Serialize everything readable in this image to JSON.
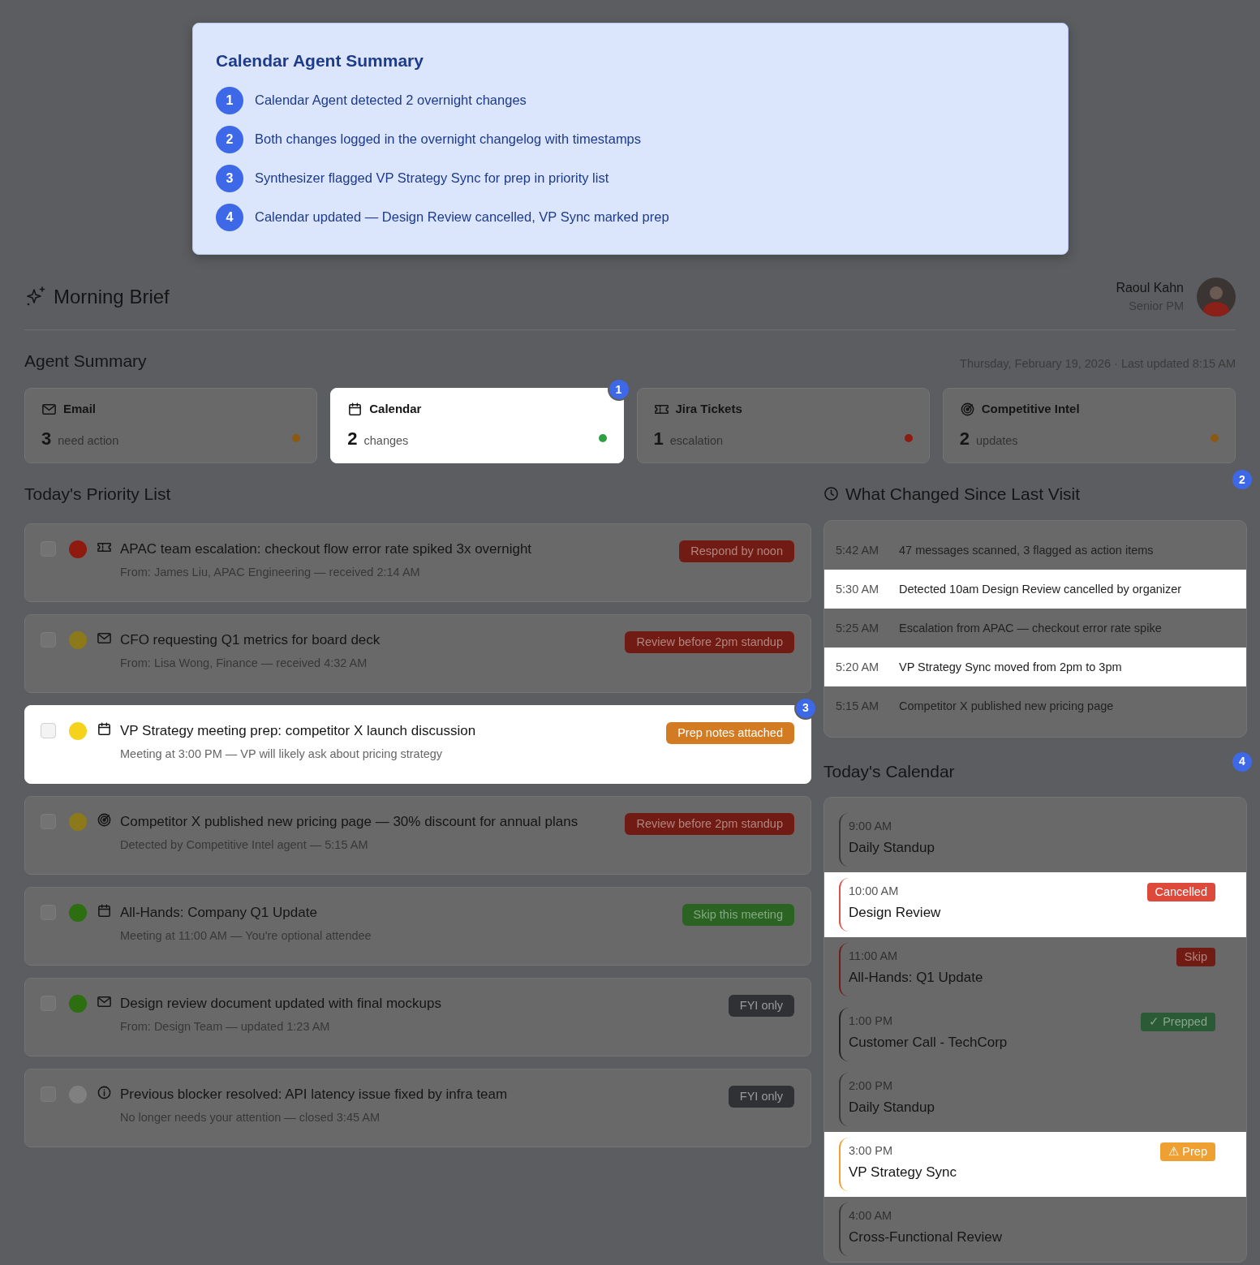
{
  "tour_popover": {
    "title": "Calendar Agent Summary",
    "steps": [
      {
        "number": "1",
        "text": "Calendar Agent detected 2 overnight changes"
      },
      {
        "number": "2",
        "text": "Both changes logged in the overnight changelog with timestamps"
      },
      {
        "number": "3",
        "text": "Synthesizer flagged VP Strategy Sync for prep in priority list"
      },
      {
        "number": "4",
        "text": "Calendar updated — Design Review cancelled, VP Sync marked prep"
      }
    ]
  },
  "header": {
    "title": "Morning Brief",
    "user_name": "Raoul Kahn",
    "user_role": "Senior PM"
  },
  "agent_summary": {
    "title": "Agent Summary",
    "date_line": "Thursday, February 19, 2026 · Last updated 8:15 AM",
    "cards": [
      {
        "kind": "email",
        "label": "Email",
        "count": "3",
        "unit": "need action",
        "color": "#8a5a12",
        "highlighted": false
      },
      {
        "kind": "calendar",
        "label": "Calendar",
        "count": "2",
        "unit": "changes",
        "color": "#2ea043",
        "highlighted": true,
        "marker": "1"
      },
      {
        "kind": "jira",
        "label": "Jira Tickets",
        "count": "1",
        "unit": "escalation",
        "color": "#8c1c12",
        "highlighted": false
      },
      {
        "kind": "intel",
        "label": "Competitive Intel",
        "count": "2",
        "unit": "updates",
        "color": "#8a5a12",
        "highlighted": false
      }
    ]
  },
  "priority_list": {
    "title": "Today's Priority List",
    "items": [
      {
        "kind": "jira",
        "title": "APAC team escalation: checkout flow error rate spiked 3x overnight",
        "detail": "From: James Liu, APAC Engineering — received 2:14 AM",
        "badge": {
          "kind": "danger",
          "text": "Respond by noon"
        },
        "color": "#8e1a10",
        "checked": false,
        "highlighted": false
      },
      {
        "kind": "email",
        "title": "CFO requesting Q1 metrics for board deck",
        "detail": "From: Lisa Wong, Finance — received 4:32 AM",
        "badge": {
          "kind": "danger",
          "text": "Review before 2pm standup"
        },
        "color": "#8c7a1a",
        "checked": false,
        "highlighted": false
      },
      {
        "kind": "calendar",
        "title": "VP Strategy meeting prep: competitor X launch discussion",
        "detail": "Meeting at 3:00 PM — VP will likely ask about pricing strategy",
        "badge": {
          "kind": "warning",
          "text": "Prep notes attached"
        },
        "color": "#f5d31c",
        "checked": false,
        "highlighted": true,
        "marker": "3"
      },
      {
        "kind": "intel",
        "title": "Competitor X published new pricing page — 30% discount for annual plans",
        "detail": "Detected by Competitive Intel agent — 5:15 AM",
        "badge": {
          "kind": "danger",
          "text": "Review before 2pm standup"
        },
        "color": "#8c7a1a",
        "checked": false,
        "highlighted": false
      },
      {
        "kind": "calendar",
        "title": "All-Hands: Company Q1 Update",
        "detail": "Meeting at 11:00 AM — You're optional attendee",
        "badge": {
          "kind": "success",
          "text": "Skip this meeting"
        },
        "color": "#2c6e10",
        "checked": false,
        "highlighted": false
      },
      {
        "kind": "email",
        "title": "Design review document updated with final mockups",
        "detail": "From: Design Team — updated 1:23 AM",
        "badge": {
          "kind": "secondary",
          "text": "FYI only"
        },
        "color": "#2c6e10",
        "checked": false,
        "highlighted": false
      },
      {
        "kind": "resolved",
        "title": "Previous blocker resolved: API latency issue fixed by infra team",
        "detail": "No longer needs your attention — closed 3:45 AM",
        "badge": {
          "kind": "secondary",
          "text": "FYI only"
        },
        "color": "#808080",
        "checked": false,
        "highlighted": false
      }
    ]
  },
  "changes": {
    "title": "What Changed Since Last Visit",
    "marker": "2",
    "rows": [
      {
        "time": "5:42 AM",
        "text": "47 messages scanned, 3 flagged as action items",
        "highlighted": false
      },
      {
        "time": "5:30 AM",
        "text": "Detected 10am Design Review cancelled by organizer",
        "highlighted": true
      },
      {
        "time": "5:25 AM",
        "text": "Escalation from APAC — checkout error rate spike",
        "highlighted": false
      },
      {
        "time": "5:20 AM",
        "text": "VP Strategy Sync moved from 2pm to 3pm",
        "highlighted": true
      },
      {
        "time": "5:15 AM",
        "text": "Competitor X published new pricing page",
        "highlighted": false
      }
    ]
  },
  "calendar": {
    "title": "Today's Calendar",
    "marker": "4",
    "events": [
      {
        "time": "9:00 AM",
        "title": "Daily Standup",
        "color": "#3a3a3a",
        "highlighted": false
      },
      {
        "time": "10:00 AM",
        "title": "Design Review",
        "color": "#d9534f",
        "badge": {
          "kind": "cancelled",
          "text": "Cancelled"
        },
        "highlighted": true
      },
      {
        "time": "11:00 AM",
        "title": "All-Hands: Q1 Update",
        "color": "#6e2018",
        "badge": {
          "kind": "skip",
          "text": "Skip"
        },
        "highlighted": false
      },
      {
        "time": "1:00 PM",
        "title": "Customer Call - TechCorp",
        "color": "#242424",
        "badge": {
          "kind": "prepped",
          "text": "✓ Prepped"
        },
        "highlighted": false
      },
      {
        "time": "2:00 PM",
        "title": "Daily Standup",
        "color": "#3a3a3a",
        "highlighted": false
      },
      {
        "time": "3:00 PM",
        "title": "VP Strategy Sync",
        "color": "#f0a030",
        "badge": {
          "kind": "prep",
          "text": "⚠ Prep"
        },
        "highlighted": true
      },
      {
        "time": "4:00 AM",
        "title": "Cross-Functional Review",
        "color": "#3a3a3a",
        "highlighted": false
      }
    ]
  }
}
